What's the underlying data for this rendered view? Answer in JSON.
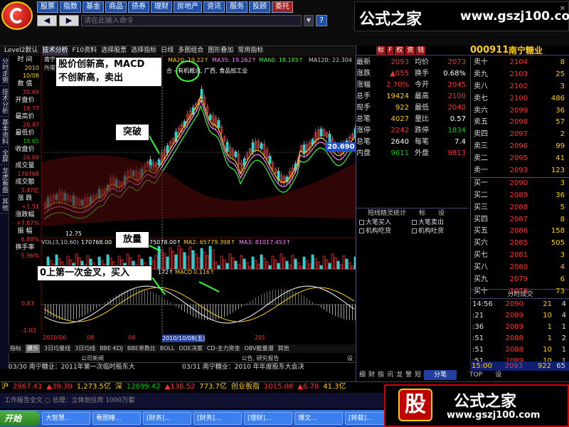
{
  "menubar": {
    "items": [
      "股票",
      "指数",
      "基金",
      "商品",
      "债券",
      "理财",
      "房地产",
      "资讯",
      "服务",
      "投顾",
      "委托"
    ],
    "active_index": 10
  },
  "nav": {
    "back": "◀",
    "forward": "▶",
    "placeholder": "请在此输入命令",
    "help": "?"
  },
  "brand_top": {
    "name_cn": "公式之家",
    "url": "www.gszj100.com",
    "close": "✕"
  },
  "tabs": [
    "Level2默认",
    "技术分析",
    "F10资料",
    "选择股票",
    "选择指标",
    "日线",
    "多图组合",
    "图形叠加",
    "常用指标"
  ],
  "sidebar": [
    "分时走势",
    "技术分析",
    "基本资料",
    "全屏",
    "龙虎看盘",
    "其他"
  ],
  "leftinfo": {
    "rows": [
      {
        "label": "时 间",
        "value": ""
      },
      {
        "label": "",
        "value": "2010"
      },
      {
        "label": "",
        "value": "10/08"
      },
      {
        "label": "数 值",
        "value": ""
      },
      {
        "label": "",
        "value": "20.69"
      },
      {
        "label": "开盘价",
        "value": "19.77"
      },
      {
        "label": "最高价",
        "value": "20.97"
      },
      {
        "label": "最低价",
        "value": "19.65"
      },
      {
        "label": "收盘价",
        "value": "20.69"
      },
      {
        "label": "成交量",
        "value": "170768"
      },
      {
        "label": "成交额",
        "value": "3.47亿"
      },
      {
        "label": "涨 跌",
        "value": "+1.51"
      },
      {
        "label": "涨跌幅",
        "value": "+7.87%"
      },
      {
        "label": "振 幅",
        "value": "6.88%"
      },
      {
        "label": "换手率",
        "value": "5.96%"
      }
    ]
  },
  "chart_header": {
    "stock": "南宁",
    "indicator": "所需",
    "ma_text": "MA20: 19.22↑",
    "ma35": "MA35: 19.262↑",
    "ma60": "MA60: 18.185↑",
    "ma120": "MA120: 22.304",
    "industry": "合 - 有机概念, 广西, 食品加工业"
  },
  "annotations": {
    "a1": [
      "股价创新高，MACD",
      "不创新高，卖出"
    ],
    "a2": "突破",
    "a3": "放量",
    "a4": "0上第一次金叉，买入"
  },
  "price_tag": "20.690",
  "low_label": "12.75",
  "vol_header": {
    "label": "VOL(3,10,60)",
    "v": "170768.00",
    "ma1": "75078.00↑",
    "ma2": "MA2: 65779.398↑",
    "ma3": "MA3: 81017.453↑"
  },
  "macd_header": {
    "label": "MACD",
    "val": "0.116↑",
    "dif": "172↑"
  },
  "scale": {
    "s1": "0.83",
    "s2": "-1.03"
  },
  "xaxis": [
    "2010/06",
    "08",
    "09",
    "2010/10/08(五)",
    "201"
  ],
  "bottom_tabs": [
    "指标",
    "摸乐",
    "3日均量线",
    "3日均线",
    "BBE-KDJ",
    "BBE单数比",
    "BOLL",
    "DDE决策",
    "CD-主力资金",
    "OBV能量潮",
    "其他"
  ],
  "news": {
    "headers": [
      "公司新闻",
      "公告, 研究报告",
      "设"
    ],
    "items": [
      "03/30 南宁糖业：2011年第一次临时股东大",
      "03/31 南宁糖业：2010 年年度股东大会决"
    ]
  },
  "statusbar": [
    {
      "t": "沪",
      "c": "#ffd000"
    },
    {
      "t": "2967.41",
      "c": "#ff3030"
    },
    {
      "t": "▲39.30",
      "c": "#ff3030"
    },
    {
      "t": "1,273.5亿",
      "c": "#ffd000"
    },
    {
      "t": "深",
      "c": "#ffd000"
    },
    {
      "t": "12699.42",
      "c": "#00d000"
    },
    {
      "t": "▲136.52",
      "c": "#ff3030"
    },
    {
      "t": "773.7亿",
      "c": "#ffd000"
    },
    {
      "t": "创业板指",
      "c": "#ffd000"
    },
    {
      "t": "1015.08",
      "c": "#ff3030"
    },
    {
      "t": "▲6.78",
      "c": "#ff3030"
    },
    {
      "t": "41.3亿",
      "c": "#ffd000"
    }
  ],
  "ticker": "工作报告全文 ○ 总理：立体划住房 1000万套",
  "taskbar": {
    "start": "开始",
    "tasks": [
      "大智慧...",
      "看图睡...",
      "[财务]...",
      "[财务]...",
      "[理财]...",
      "博文...",
      "[转载]..."
    ]
  },
  "brand_bottom": {
    "icon": "股",
    "name_cn": "公式之家",
    "url": "www.gszj100.com"
  },
  "right_header": {
    "buttons": [
      "标",
      "F",
      "权",
      "资",
      "钱"
    ],
    "code": "000911",
    "name": "南宁糖业",
    "more": "▸"
  },
  "quote": [
    {
      "l": "最新",
      "v": "2093",
      "vc": "r",
      "l2": "均价",
      "v2": "2073",
      "v2c": "r"
    },
    {
      "l": "涨跌",
      "v": "▲055",
      "vc": "r",
      "l2": "换手",
      "v2": "0.68%",
      "v2c": "w"
    },
    {
      "l": "涨幅",
      "v": "2.70%",
      "vc": "r",
      "l2": "今开",
      "v2": "2045",
      "v2c": "r"
    },
    {
      "l": "总手",
      "v": "19424",
      "vc": "y",
      "l2": "最高",
      "v2": "2100",
      "v2c": "r"
    },
    {
      "l": "现手",
      "v": "922",
      "vc": "y",
      "l2": "最低",
      "v2": "2040",
      "v2c": "r"
    },
    {
      "l": "总笔",
      "v": "4027",
      "vc": "y",
      "l2": "量比",
      "v2": "0.57",
      "v2c": "w"
    },
    {
      "l": "涨停",
      "v": "2242",
      "vc": "r",
      "l2": "跌停",
      "v2": "1834",
      "v2c": "gr"
    },
    {
      "l": "总笔",
      "v": "2640",
      "vc": "w",
      "l2": "每笔",
      "v2": "7.4",
      "v2c": "w"
    },
    {
      "l": "内盘",
      "v": "9611",
      "vc": "gr",
      "l2": "外盘",
      "v2": "9813",
      "v2c": "r"
    }
  ],
  "asks": [
    {
      "l": "卖十",
      "p": "2104",
      "v": "8"
    },
    {
      "l": "卖九",
      "p": "2103",
      "v": "25"
    },
    {
      "l": "卖八",
      "p": "2102",
      "v": "3"
    },
    {
      "l": "卖七",
      "p": "2100",
      "v": "486"
    },
    {
      "l": "卖六",
      "p": "2099",
      "v": "36"
    },
    {
      "l": "卖五",
      "p": "2098",
      "v": "57"
    },
    {
      "l": "卖四",
      "p": "2097",
      "v": "2"
    },
    {
      "l": "卖三",
      "p": "2096",
      "v": "99"
    },
    {
      "l": "卖二",
      "p": "2095",
      "v": "41"
    },
    {
      "l": "卖一",
      "p": "2093",
      "v": "123"
    }
  ],
  "bids": [
    {
      "l": "买一",
      "p": "2090",
      "v": "3"
    },
    {
      "l": "买二",
      "p": "2089",
      "v": "36"
    },
    {
      "l": "买三",
      "p": "2088",
      "v": "5"
    },
    {
      "l": "买四",
      "p": "2087",
      "v": "8"
    },
    {
      "l": "买五",
      "p": "2086",
      "v": "158"
    },
    {
      "l": "买六",
      "p": "2085",
      "v": "505"
    },
    {
      "l": "买七",
      "p": "2081",
      "v": "3"
    },
    {
      "l": "买八",
      "p": "2080",
      "v": "4"
    },
    {
      "l": "买九",
      "p": "2079",
      "v": "6"
    },
    {
      "l": "买十",
      "p": "2078",
      "v": "73"
    }
  ],
  "stats": {
    "title": "短线精灵统计",
    "b1": "标",
    "b2": "设",
    "items": [
      "大笔买入",
      "大笔卖出",
      "机构吃货",
      "机构吐货"
    ]
  },
  "trades_title": "分时成交",
  "trades": [
    {
      "t": "14:56",
      "p": "2090",
      "v": "21",
      "s": "4"
    },
    {
      "t": ":21",
      "p": "2089",
      "v": "10",
      "s": "4"
    },
    {
      "t": ":36",
      "p": "2089",
      "v": "1",
      "s": "1"
    },
    {
      "t": ":51",
      "p": "2088",
      "v": "1",
      "s": "2"
    },
    {
      "t": ":51",
      "p": "2088",
      "v": "10",
      "s": "1"
    },
    {
      "t": ":51",
      "p": "2089",
      "v": "10",
      "s": "1"
    }
  ],
  "trade_close": {
    "t": "15:00",
    "p": "2093",
    "v": "922",
    "s": "65"
  },
  "rfoot": [
    "细",
    "财",
    "指",
    "讯",
    "龙",
    "警",
    "短",
    "分笔",
    "TOP",
    "设"
  ]
}
